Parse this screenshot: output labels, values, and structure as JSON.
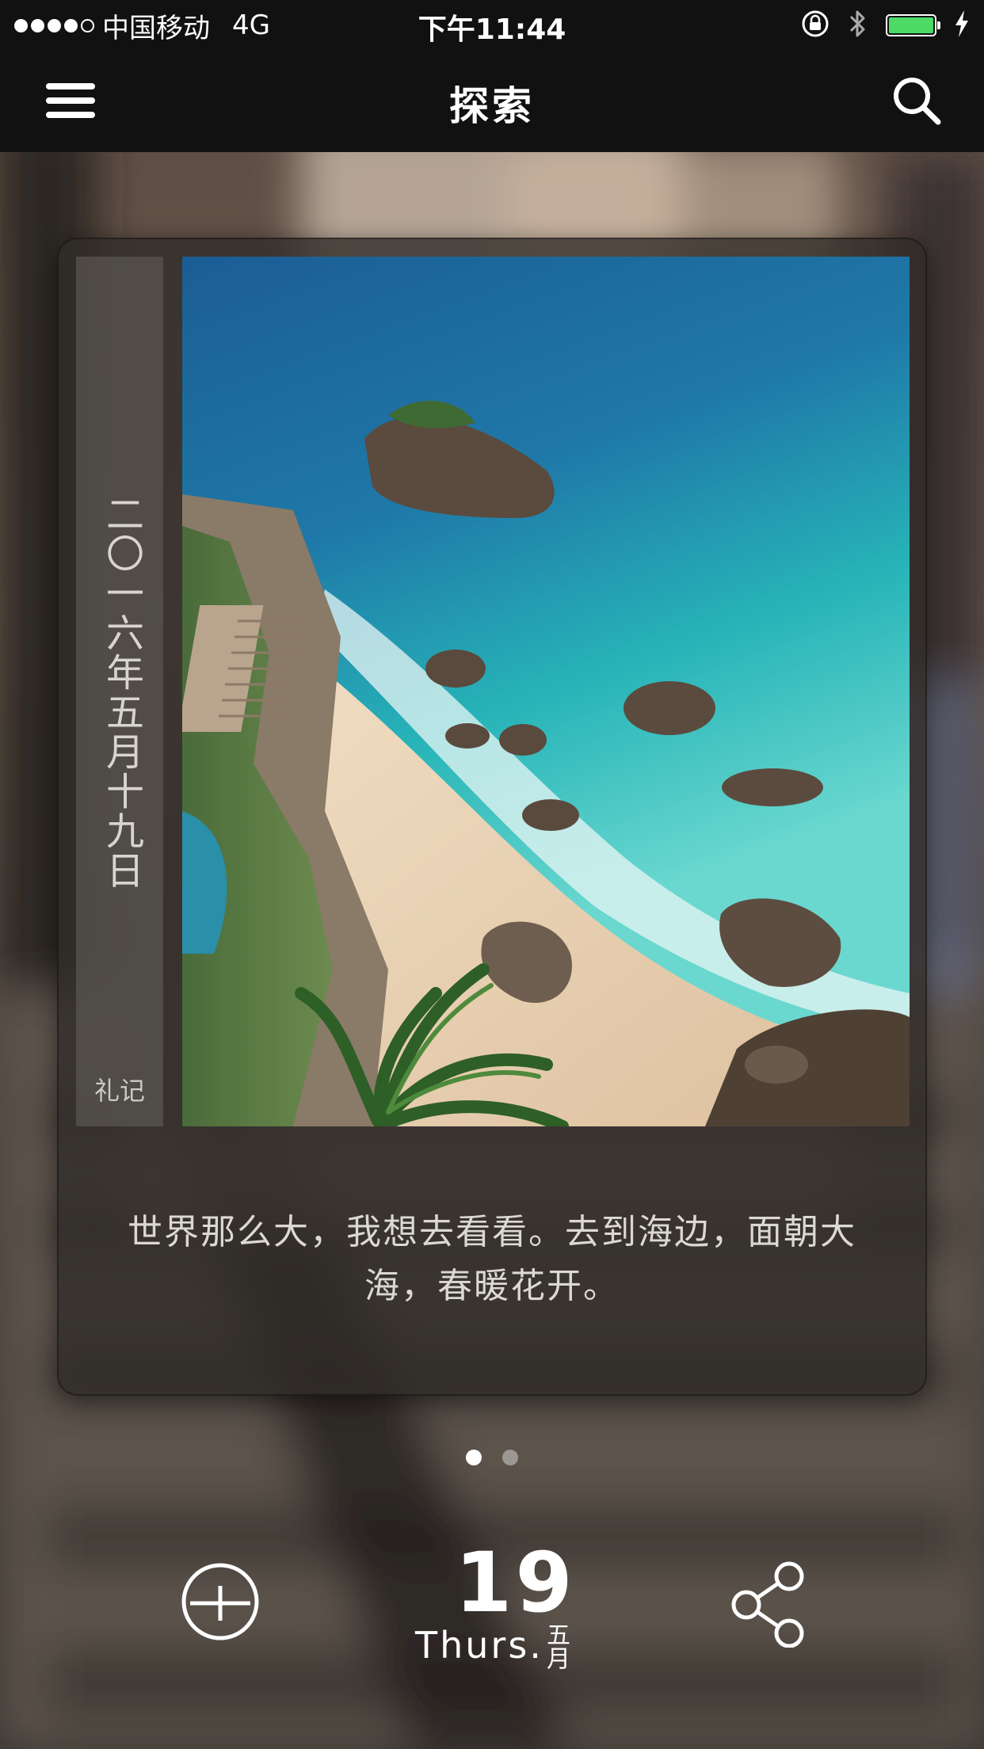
{
  "status_bar": {
    "carrier": "中国移动",
    "network": "4G",
    "time": "下午11:44",
    "signal_bars": 4,
    "battery_level": 1.0,
    "icons": [
      "orientation-lock-icon",
      "bluetooth-icon",
      "battery-icon",
      "charging-icon"
    ]
  },
  "nav": {
    "title": "探索",
    "menu_icon": "menu-icon",
    "search_icon": "search-icon"
  },
  "card": {
    "date_text": "二〇一六年五月十九日",
    "brand": "礼记",
    "quote": "世界那么大，我想去看看。去到海边，面朝大海，春暖花开。",
    "photo": "seaside-cliff-beach-photo"
  },
  "pager": {
    "count": 2,
    "active_index": 0
  },
  "toolbar": {
    "add_icon": "add-circle-icon",
    "share_icon": "share-icon",
    "day": "19",
    "weekday": "Thurs.",
    "month": "五月"
  },
  "colors": {
    "bar_background": "#111111",
    "battery": "#4cd964",
    "sea_deep": "#1f5f92",
    "sea_shallow": "#2fc4c0",
    "sand": "#e9d3b4"
  }
}
